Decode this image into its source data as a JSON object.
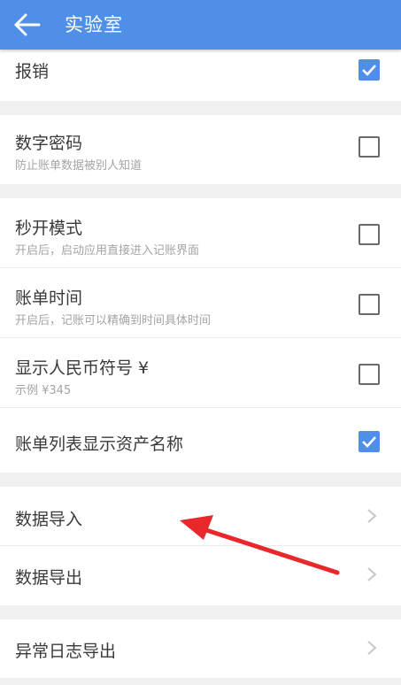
{
  "appbar": {
    "title": "实验室",
    "back_icon": "arrow-left-icon"
  },
  "colors": {
    "primary": "#4f8fe8",
    "annotation_arrow": "#e8282a"
  },
  "settings": {
    "reimburse": {
      "title": "报销",
      "checked": true
    },
    "digit_password": {
      "title": "数字密码",
      "subtitle": "防止账单数据被别人知道",
      "checked": false
    },
    "quick_open": {
      "title": "秒开模式",
      "subtitle": "开启后，启动应用直接进入记账界面",
      "checked": false
    },
    "bill_time": {
      "title": "账单时间",
      "subtitle": "开启后，记账可以精确到时间具体时间",
      "checked": false
    },
    "show_rmb": {
      "title": "显示人民币符号 ¥",
      "subtitle": "示例 ¥345",
      "checked": false
    },
    "show_asset_name": {
      "title": "账单列表显示资产名称",
      "checked": true
    }
  },
  "actions": {
    "import": {
      "title": "数据导入"
    },
    "export": {
      "title": "数据导出"
    },
    "error_log": {
      "title": "异常日志导出"
    }
  }
}
